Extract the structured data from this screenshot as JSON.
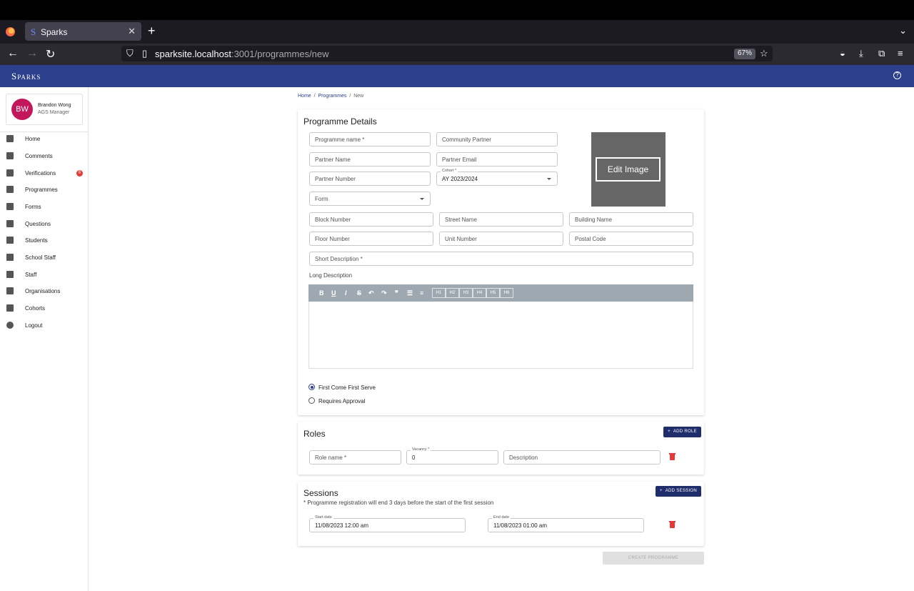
{
  "browser": {
    "tab_title": "Sparks",
    "tab_favicon": "S",
    "url_host": "sparksite.localhost",
    "url_path": ":3001/programmes/new",
    "zoom": "67%"
  },
  "app": {
    "brand": "Sparks",
    "accent_color": "#2b3f8c"
  },
  "user": {
    "initials": "BW",
    "name": "Brandon Wong",
    "role": "AGS Manager"
  },
  "sidebar": {
    "items": [
      {
        "label": "Home",
        "icon": "home-icon"
      },
      {
        "label": "Comments",
        "icon": "comment-icon"
      },
      {
        "label": "Verifications",
        "icon": "checkbox-icon",
        "badge": "6"
      },
      {
        "label": "Programmes",
        "icon": "document-icon"
      },
      {
        "label": "Forms",
        "icon": "clipboard-icon"
      },
      {
        "label": "Questions",
        "icon": "forum-icon"
      },
      {
        "label": "Students",
        "icon": "person-icon"
      },
      {
        "label": "School Staff",
        "icon": "school-staff-icon"
      },
      {
        "label": "Staff",
        "icon": "badge-icon"
      },
      {
        "label": "Organisations",
        "icon": "school-icon"
      },
      {
        "label": "Cohorts",
        "icon": "globe-icon"
      },
      {
        "label": "Logout",
        "icon": "power-icon"
      }
    ]
  },
  "breadcrumb": {
    "home": "Home",
    "programmes": "Programmes",
    "current": "New",
    "sep": "/"
  },
  "details": {
    "title": "Programme Details",
    "programme_name_ph": "Programme name *",
    "community_partner_ph": "Community Partner",
    "partner_name_ph": "Partner Name",
    "partner_email_ph": "Partner Email",
    "partner_number_ph": "Partner Number",
    "cohort_label": "Cohort *",
    "cohort_value": "AY 2023/2024",
    "form_ph": "Form",
    "edit_image": "Edit Image",
    "block_number_ph": "Block Number",
    "street_name_ph": "Street Name",
    "building_name_ph": "Building Name",
    "floor_number_ph": "Floor Number",
    "unit_number_ph": "Unit Number",
    "postal_code_ph": "Postal Code",
    "short_desc_ph": "Short Description *",
    "long_desc_label": "Long Description",
    "toolbar": {
      "bold": "B",
      "underline": "U",
      "italic": "I",
      "strike": "S",
      "undo": "↶",
      "redo": "↷",
      "quote": "❞",
      "bullets": "☰",
      "numbers": "≡",
      "headings": [
        "H1",
        "H2",
        "H3",
        "H4",
        "H5",
        "H6"
      ]
    },
    "radio_fcfs": "First Come First Serve",
    "radio_approval": "Requires Approval",
    "selected_mode": "First Come First Serve"
  },
  "roles": {
    "title": "Roles",
    "add_label": "ADD ROLE",
    "role_name_ph": "Role name *",
    "vacancy_label": "Vacancy *",
    "vacancy_value": "0",
    "description_ph": "Description"
  },
  "sessions": {
    "title": "Sessions",
    "add_label": "ADD SESSION",
    "note": "* Programme registration will end 3 days before the start of the first session",
    "start_label": "Start date",
    "start_value": "11/08/2023 12:00 am",
    "end_label": "End date",
    "end_value": "11/08/2023 01:00 am"
  },
  "create_label": "CREATE PROGRAMME",
  "plus": "+"
}
